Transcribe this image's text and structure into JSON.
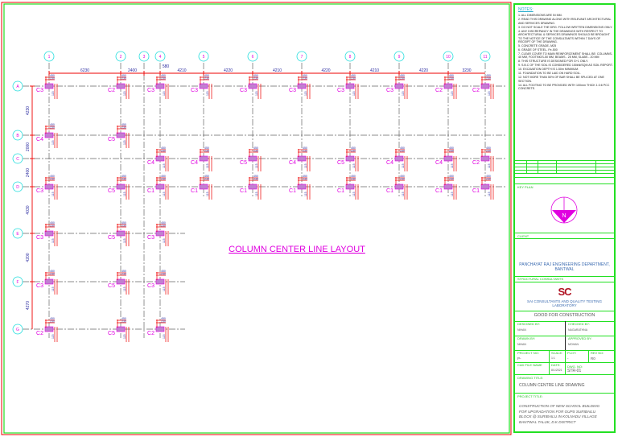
{
  "drawing": {
    "title": "COLUMN CENTER LINE  LAYOUT",
    "grid_columns": [
      "1",
      "2",
      "3",
      "4",
      "5",
      "6",
      "7",
      "8",
      "9",
      "10",
      "11"
    ],
    "grid_rows": [
      "A",
      "B",
      "C",
      "D",
      "E",
      "F",
      "G"
    ],
    "horizontal_dims": [
      "6230",
      "2400",
      "580",
      "4210",
      "4220",
      "4210",
      "4220",
      "4210",
      "4220",
      "3230"
    ],
    "vertical_dims": [
      "4230",
      "2000",
      "2400",
      "4030",
      "4200",
      "4270"
    ],
    "column_dims": {
      "w": "450",
      "h": "230",
      "off": "115"
    },
    "columns": [
      {
        "row": "A",
        "col": "1",
        "label": "C3"
      },
      {
        "row": "A",
        "col": "2",
        "label": "C2"
      },
      {
        "row": "A",
        "col": "4",
        "label": "C3"
      },
      {
        "row": "A",
        "col": "5",
        "label": "C3"
      },
      {
        "row": "A",
        "col": "6",
        "label": "C3"
      },
      {
        "row": "A",
        "col": "7",
        "label": "C3"
      },
      {
        "row": "A",
        "col": "8",
        "label": "C3"
      },
      {
        "row": "A",
        "col": "9",
        "label": "C3"
      },
      {
        "row": "A",
        "col": "10",
        "label": "C2"
      },
      {
        "row": "A",
        "col": "11",
        "label": "C2"
      },
      {
        "row": "B",
        "col": "1",
        "label": "C4"
      },
      {
        "row": "B",
        "col": "2",
        "label": "C5"
      },
      {
        "row": "C",
        "col": "4",
        "label": "C4"
      },
      {
        "row": "C",
        "col": "5",
        "label": "C4"
      },
      {
        "row": "C",
        "col": "6",
        "label": "C5"
      },
      {
        "row": "C",
        "col": "7",
        "label": "C4"
      },
      {
        "row": "C",
        "col": "8",
        "label": "C5"
      },
      {
        "row": "C",
        "col": "9",
        "label": "C4"
      },
      {
        "row": "C",
        "col": "10",
        "label": "C4"
      },
      {
        "row": "C",
        "col": "11",
        "label": "C2"
      },
      {
        "row": "D",
        "col": "1",
        "label": "C3"
      },
      {
        "row": "D",
        "col": "2",
        "label": "C5"
      },
      {
        "row": "D",
        "col": "4",
        "label": "C1"
      },
      {
        "row": "D",
        "col": "5",
        "label": "C1"
      },
      {
        "row": "D",
        "col": "6",
        "label": "C1"
      },
      {
        "row": "D",
        "col": "7",
        "label": "C1"
      },
      {
        "row": "D",
        "col": "8",
        "label": "C1"
      },
      {
        "row": "D",
        "col": "9",
        "label": "C1"
      },
      {
        "row": "D",
        "col": "10",
        "label": "C1"
      },
      {
        "row": "D",
        "col": "11",
        "label": "C1"
      },
      {
        "row": "E",
        "col": "1",
        "label": "C3"
      },
      {
        "row": "E",
        "col": "2",
        "label": "C5"
      },
      {
        "row": "E",
        "col": "4",
        "label": "C3"
      },
      {
        "row": "F",
        "col": "1",
        "label": "C3"
      },
      {
        "row": "F",
        "col": "2",
        "label": "C5"
      },
      {
        "row": "F",
        "col": "4",
        "label": "C3"
      },
      {
        "row": "G",
        "col": "1",
        "label": "C2"
      },
      {
        "row": "G",
        "col": "2",
        "label": "C5"
      },
      {
        "row": "G",
        "col": "4",
        "label": "C2"
      }
    ]
  },
  "title_block": {
    "notes_heading": "NOTES:",
    "notes": [
      "1. ALL DIMENSIONS ARE IN MM.",
      "2. READ THIS DRAWING ALONG WITH RELEVANT ARCHITECTURAL AND SERVICES DRAWING.",
      "3. DO NOT SCALE THE DRG. FOLLOW WRITTEN DIMENSIONS ONLY.",
      "4. ANY DISCREPANCY IN THE DRAWINGS WITH RESPECT TO ARCHITECTURAL & SERVICES DRAWINGS SHOULD BE BROUGHT TO THE NOTICE OF THE CONSULTANTS WITHIN 7 DAYS OF RECEIPT OF THE DRAWING.",
      "5. CONCRETE GRADE- M25",
      "6. GRADE OF STEEL- Fe-500",
      "7. CLEAR COVER TO MAIN REINFORCEMENT SHALL BE: COLUMNS-40 MM, FOOTINGS-50 MM, BEAMS - 25 MM, SLABS - 20 MM",
      "8. THIS STRUCTURE IS DESIGNED FOR G+1 ONLY.",
      "9. S.B.C OF THE SOIL IS CONSIDERED 150kN/SQM AS SOIL REPORT.",
      "10. EXCAVATION DEPTH IS 1.50m MINIMUM.",
      "11. FOUNDATION TO BE LAID ON HARD SOIL.",
      "12. NOT MORE THAN 50% OF BAR SHALL BE SPLICED AT ONE SECTION.",
      "14. ALL FOOTING TO BE PROVIDED WITH 100mm THICK 1:3:6 PCC CONCRETE."
    ],
    "key_plan_label": "KEY PLAN",
    "client_label": "CLIENT",
    "client": "PANCHAYAT RAJ ENGINEERING DEPARTMENT, BANTWAL",
    "consultants_label": "STRUCTURAL CONSULTANTS",
    "consultant_logo": "SC",
    "consultant": "SAI CONSULTANTS AND QUALITY TESTING LABORATORY",
    "status": "GOOD FOR CONSTRUCTION",
    "designed_by_label": "DESIGNED BY:",
    "designed_by": "NIHAN",
    "checked_by_label": "CHECKED BY:",
    "checked_by": "NAGARATHNA",
    "drawn_by_label": "DRAWN BY:",
    "drawn_by": "NIHAN",
    "approved_by_label": "APPROVED BY:",
    "approved_by": "MOHAN",
    "project_no_label": "PROJECT NO:",
    "project_no": "P-",
    "scale_label": "SCALE:",
    "scale": "1:1",
    "plot_label": "PLOT:",
    "plot": "-",
    "rev_label": "REV NO:",
    "rev": "R0",
    "cad_label": "CAD FILE NAME",
    "date_label": "DATE:",
    "date": "8/1/2021",
    "dwg_label": "DWG. NO:",
    "dwg": "STR-01",
    "drawing_title_label": "DRAWING TITLE:",
    "drawing_title": "COLUMN CENTRE LINE DRAWING",
    "project_title_label": "PROJECT TITLE:",
    "project_title": "CONSTRUCTION OF NEW SCHOOL BUILDING FOR UPGRADATION FOR GUPS SURIBAILU BLOCK @ SURIBAILU IN KOLNADU VILLAGE BANTWAL TALUK, D.K DISTRICT",
    "colors": {
      "border": "#22e022",
      "accent": "#e00000",
      "magenta": "#e000e0"
    }
  }
}
